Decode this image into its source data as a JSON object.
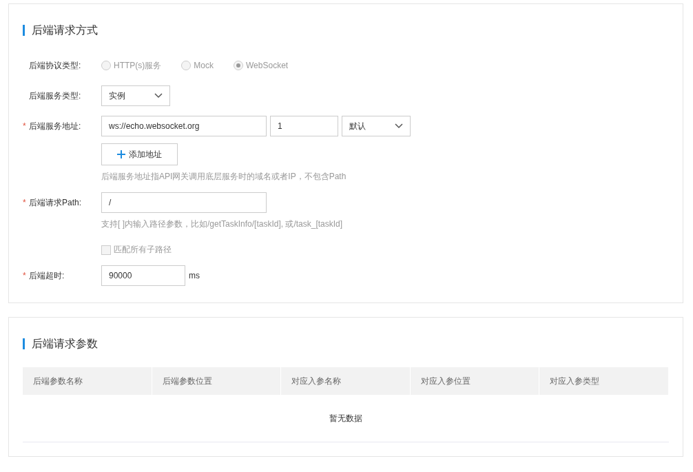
{
  "request_method": {
    "title": "后端请求方式",
    "protocol": {
      "label": "后端协议类型:",
      "options": [
        {
          "label": "HTTP(s)服务",
          "selected": false
        },
        {
          "label": "Mock",
          "selected": false
        },
        {
          "label": "WebSocket",
          "selected": true
        }
      ]
    },
    "service_type": {
      "label": "后端服务类型:",
      "value": "实例"
    },
    "address": {
      "label": "后端服务地址:",
      "required_mark": "*",
      "url": "ws://echo.websocket.org",
      "weight": "1",
      "mode": "默认",
      "add_button": "添加地址",
      "hint": "后端服务地址指API网关调用底层服务时的域名或者IP，不包含Path"
    },
    "path": {
      "label": "后端请求Path:",
      "required_mark": "*",
      "value": "/",
      "hint": "支持[ ]内输入路径参数，比如/getTaskInfo/[taskId], 或/task_[taskId]",
      "match_all": {
        "label": "匹配所有子路径",
        "checked": false
      }
    },
    "timeout": {
      "label": "后端超时:",
      "required_mark": "*",
      "value": "90000",
      "unit": "ms"
    }
  },
  "request_params": {
    "title": "后端请求参数",
    "columns": [
      "后端参数名称",
      "后端参数位置",
      "对应入参名称",
      "对应入参位置",
      "对应入参类型"
    ],
    "empty_text": "暂无数据"
  }
}
